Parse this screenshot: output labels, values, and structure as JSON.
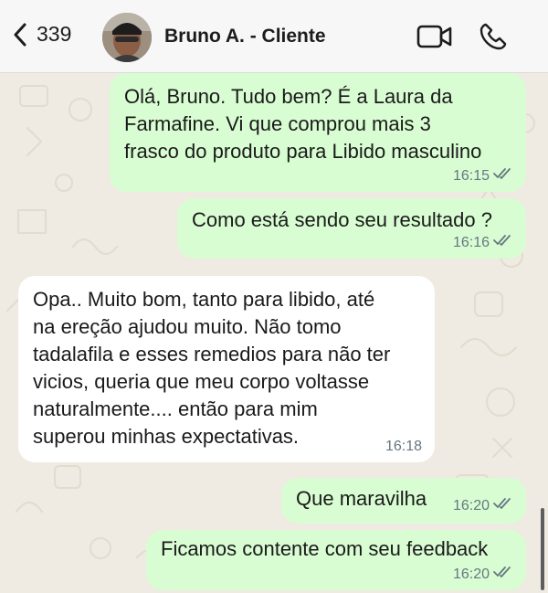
{
  "header": {
    "back_count": "339",
    "contact_name": "Bruno A. - Cliente",
    "icons": {
      "back": "chevron-left-icon",
      "video": "video-camera-icon",
      "call": "phone-icon"
    }
  },
  "messages": [
    {
      "direction": "outgoing",
      "text": "Olá, Bruno.  Tudo bem? É a Laura da\nFarmafine. Vi que comprou mais 3\nfrasco do produto para Libido masculino",
      "time": "16:15",
      "status": "read"
    },
    {
      "direction": "outgoing",
      "text": "Como está sendo seu resultado ?",
      "time": "16:16",
      "status": "read"
    },
    {
      "direction": "incoming",
      "text": "Opa.. Muito bom, tanto para libido, até\nna ereção ajudou muito. Não tomo\ntadalafila e esses remedios para não ter\nvicios, queria que meu corpo voltasse\nnaturalmente.... então para mim\nsuperou minhas expectativas.",
      "time": "16:18"
    },
    {
      "direction": "outgoing",
      "text": "Que maravilha",
      "time": "16:20",
      "status": "read"
    },
    {
      "direction": "outgoing",
      "text": "Ficamos contente com seu feedback",
      "time": "16:20",
      "status": "read"
    }
  ],
  "colors": {
    "outgoing_bubble": "#d9fdd3",
    "incoming_bubble": "#ffffff",
    "chat_background": "#efeae2",
    "header_background": "#f7f7f7",
    "meta_text": "#667781"
  }
}
